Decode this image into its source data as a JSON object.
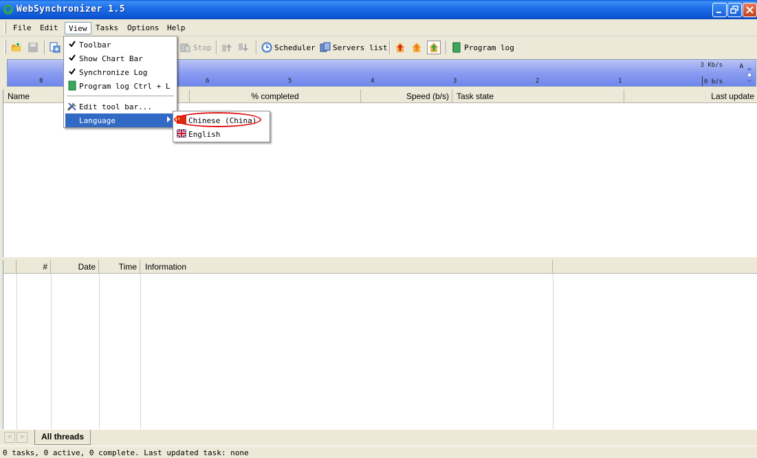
{
  "window": {
    "title": "WebSynchronizer 1.5"
  },
  "menubar": {
    "items": [
      "File",
      "Edit",
      "View",
      "Tasks",
      "Options",
      "Help"
    ],
    "active": "View"
  },
  "toolbar": {
    "stop_label": "Stop",
    "scheduler_label": "Scheduler",
    "servers_label": "Servers list",
    "program_log_label": "Program log"
  },
  "chart": {
    "ticks": [
      "8",
      "6",
      "5",
      "4",
      "3",
      "2",
      "1"
    ],
    "y_top": "3 Kb/s",
    "y_bottom": "0 b/s",
    "scroll_label": "A",
    "colors": {
      "top": "#b9c4f5",
      "bottom": "#6f86ec"
    }
  },
  "task_list": {
    "columns": [
      "Name",
      "% completed",
      "Speed (b/s)",
      "Task state",
      "Last update"
    ]
  },
  "log_list": {
    "columns": [
      "#",
      "Date",
      "Time",
      "Information"
    ]
  },
  "tabs": {
    "left_arrow": "<",
    "right_arrow": ">",
    "all_threads": "All threads"
  },
  "status": {
    "text": "0 tasks, 0 active, 0 complete. Last updated task: none"
  },
  "view_menu": {
    "toolbar": "Toolbar",
    "show_chart_bar": "Show Chart Bar",
    "synchronize_log": "Synchronize Log",
    "program_log": "Program log Ctrl + L",
    "edit_tool_bar": "Edit tool bar...",
    "language": "Language"
  },
  "language_submenu": {
    "chinese": "Chinese (China)",
    "english": "English"
  },
  "colors": {
    "highlight": "#316ac5",
    "annotation": "#e01010",
    "titlebar": "#0c55d3"
  }
}
